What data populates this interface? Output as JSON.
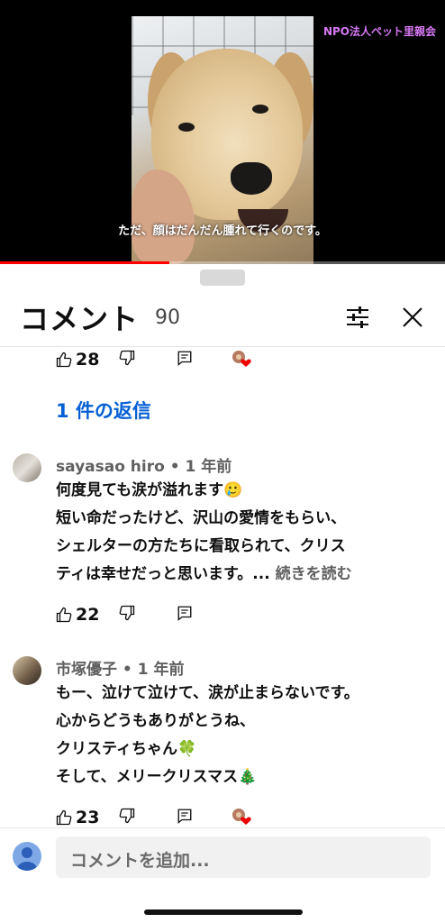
{
  "video": {
    "watermark": "NPO法人ペット里親会",
    "subtitle": "ただ、顔はだんだん腫れて行くのです。",
    "progress_fraction": 0.38,
    "progress_color": "#ff0000"
  },
  "comments_panel": {
    "title": "コメント",
    "count": "90",
    "filter_icon": "sliders-icon",
    "close_icon": "close-icon"
  },
  "top_actions": {
    "likes": "28"
  },
  "replies_link": "1 件の返信",
  "comments": [
    {
      "author": "sayasao hiro • 1 年前",
      "lines": [
        "何度見ても涙が溢れます🥲",
        "短い命だったけど、沢山の愛情をもらい、",
        "シェルターの方たちに看取られて、クリス",
        "ティは幸せだっと思います。..."
      ],
      "more": "続きを読む",
      "likes": "22"
    },
    {
      "author": "市塚優子 • 1 年前",
      "lines": [
        "もー、泣けて泣けて、涙が止まらないです。",
        "心からどうもありがとうね、",
        "クリスティちゃん🍀",
        "そして、メリークリスマス🎄"
      ],
      "likes": "23"
    }
  ],
  "input": {
    "placeholder": "コメントを追加..."
  },
  "colors": {
    "link": "#065fd4",
    "watermark": "#d878f5"
  }
}
